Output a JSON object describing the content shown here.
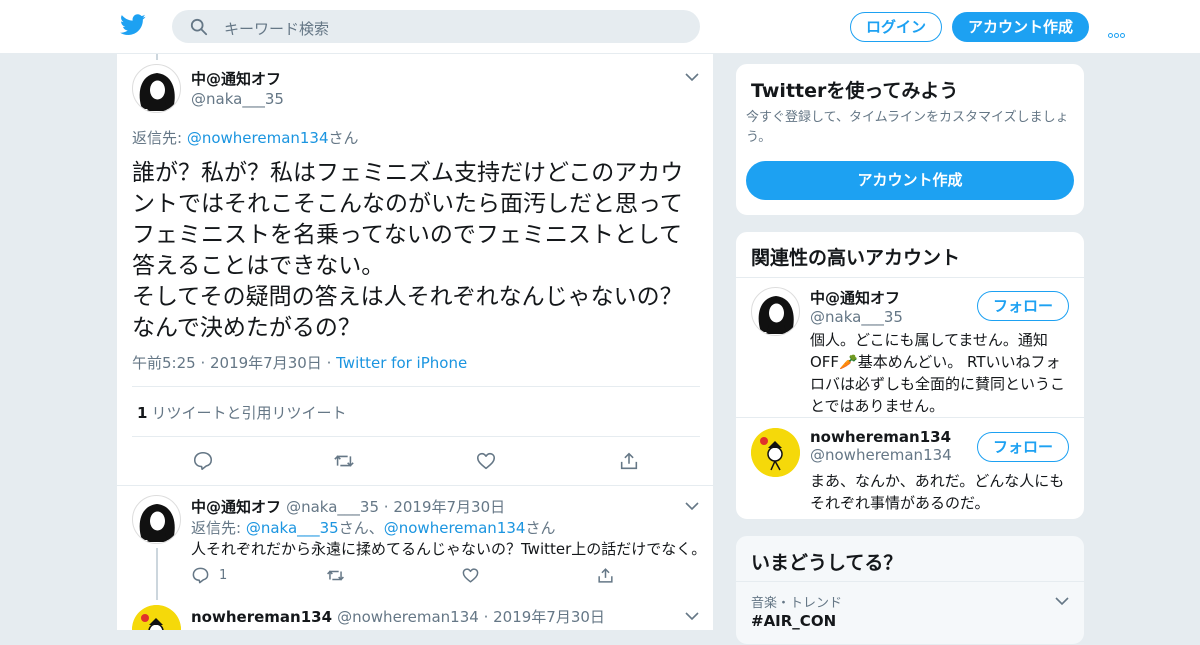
{
  "topbar": {
    "search_placeholder": "キーワード検索",
    "login_label": "ログイン",
    "signup_label": "アカウント作成"
  },
  "tweet": {
    "author_name": "中@通知オフ",
    "author_handle": "@naka___35",
    "reply_to_prefix": "返信先: ",
    "reply_to_user": "@nowhereman134",
    "reply_to_suffix": "さん",
    "text": "誰が？私が？私はフェミニズム支持だけどこのアカウントではそれこそこんなのがいたら面汚しだと思ってフェミニストを名乗ってないのでフェミニストとして答えることはできない。\nそしてその疑問の答えは人それぞれなんじゃないの？なんで決めたがるの？",
    "time": "午前5:25",
    "date": "2019年7月30日",
    "source": "Twitter for iPhone",
    "retweet_count": "1",
    "retweet_label": "リツイートと引用リツイート"
  },
  "replies": [
    {
      "author_name": "中@通知オフ",
      "author_handle": "@naka___35",
      "date": "2019年7月30日",
      "reply_to_prefix": "返信先: ",
      "reply_to_user1": "@naka___35",
      "reply_to_mid": "さん、",
      "reply_to_user2": "@nowhereman134",
      "reply_to_suffix": "さん",
      "text": "人それぞれだから永遠に揉めてるんじゃないの？Twitter上の話だけでなく。",
      "reply_count": "1"
    },
    {
      "author_name": "nowhereman134",
      "author_handle": "@nowhereman134",
      "date": "2019年7月30日"
    }
  ],
  "sidebar": {
    "signup_card": {
      "title": "Twitterを使ってみよう",
      "subtitle": "今すぐ登録して、タイムラインをカスタマイズしましょう。",
      "button": "アカウント作成"
    },
    "related_card": {
      "title": "関連性の高いアカウント",
      "follow_label": "フォロー",
      "accounts": [
        {
          "name": "中@通知オフ",
          "handle": "@naka___35",
          "bio": "個人。どこにも属してません。通知OFF🥕基本めんどい。 RTいいねフォロバは必ずしも全面的に賛同ということではありません。"
        },
        {
          "name": "nowhereman134",
          "handle": "@nowhereman134",
          "bio": "まあ、なんか、あれだ。どんな人にもそれぞれ事情があるのだ。"
        }
      ]
    },
    "trends_card": {
      "title": "いまどうしてる？",
      "trend_category": "音楽・トレンド",
      "trend_name": "#AIR_CON"
    }
  },
  "colors": {
    "brand": "#1da1f2",
    "link": "#1b95e0",
    "background": "#e6ecf0",
    "muted": "#657786"
  }
}
